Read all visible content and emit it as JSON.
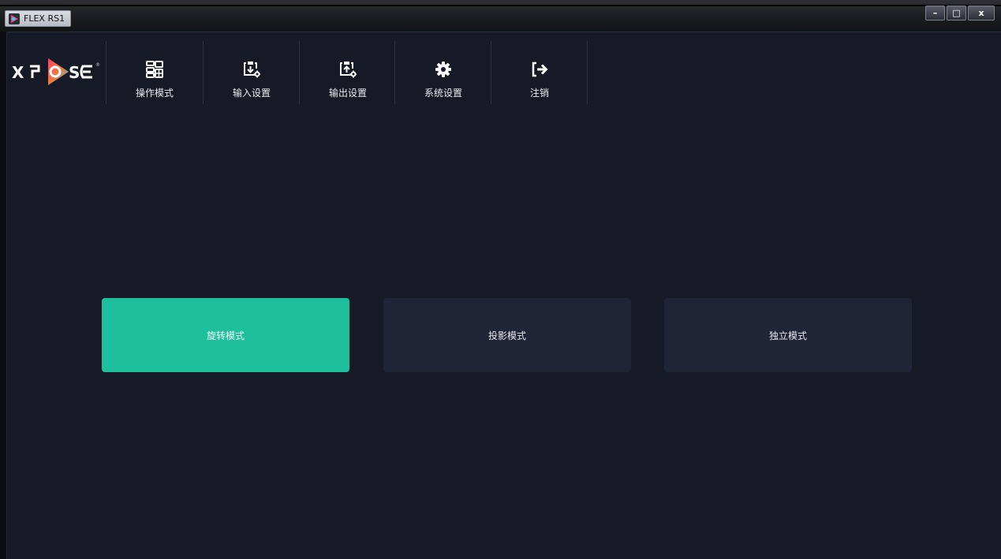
{
  "window": {
    "title": "FLEX RS1",
    "controls": {
      "minimize": "–",
      "maximize": "□",
      "close": "x"
    }
  },
  "logo": {
    "text": "XPOSE",
    "registered": "®"
  },
  "nav": {
    "items": [
      {
        "label": "操作模式",
        "icon": "operation-mode-icon"
      },
      {
        "label": "输入设置",
        "icon": "input-settings-icon"
      },
      {
        "label": "输出设置",
        "icon": "output-settings-icon"
      },
      {
        "label": "系统设置",
        "icon": "gear-icon"
      },
      {
        "label": "注销",
        "icon": "logout-icon"
      }
    ]
  },
  "modes": [
    {
      "label": "旋转模式",
      "active": true
    },
    {
      "label": "投影模式",
      "active": false
    },
    {
      "label": "独立模式",
      "active": false
    }
  ],
  "colors": {
    "background": "#151a26",
    "accent": "#1dbf9c",
    "button": "#1f2436"
  }
}
